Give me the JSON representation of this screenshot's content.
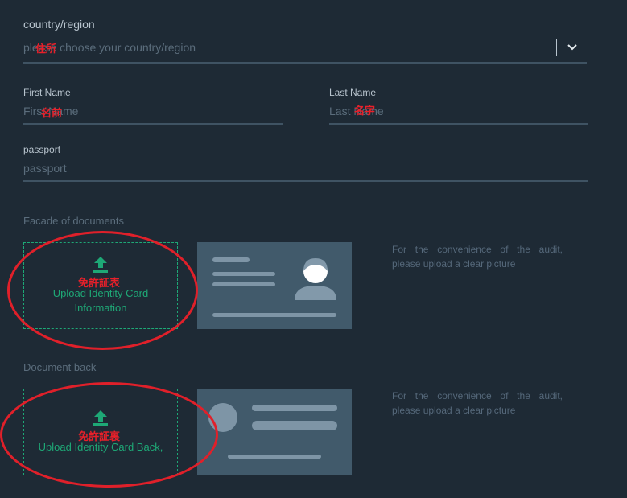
{
  "country": {
    "label": "country/region",
    "placeholder": "please choose your country/region",
    "annotation": "住所"
  },
  "first_name": {
    "label": "First Name",
    "placeholder": "First Name",
    "annotation": "名前"
  },
  "last_name": {
    "label": "Last Name",
    "placeholder": "Last Name",
    "annotation": "名字"
  },
  "passport": {
    "label": "passport",
    "placeholder": "passport"
  },
  "front": {
    "title": "Facade of documents",
    "upload_label": "Upload Identity Card Information",
    "annotation": "免許証表",
    "hint": "For the convenience of the audit, please upload a clear picture"
  },
  "back": {
    "title": "Document back",
    "upload_label": "Upload Identity Card Back,",
    "annotation": "免許証裏",
    "hint": "For the convenience of the audit, please upload a clear picture"
  },
  "colors": {
    "background": "#1e2a35",
    "accent": "#1ea876",
    "annotation": "#e0202a"
  }
}
